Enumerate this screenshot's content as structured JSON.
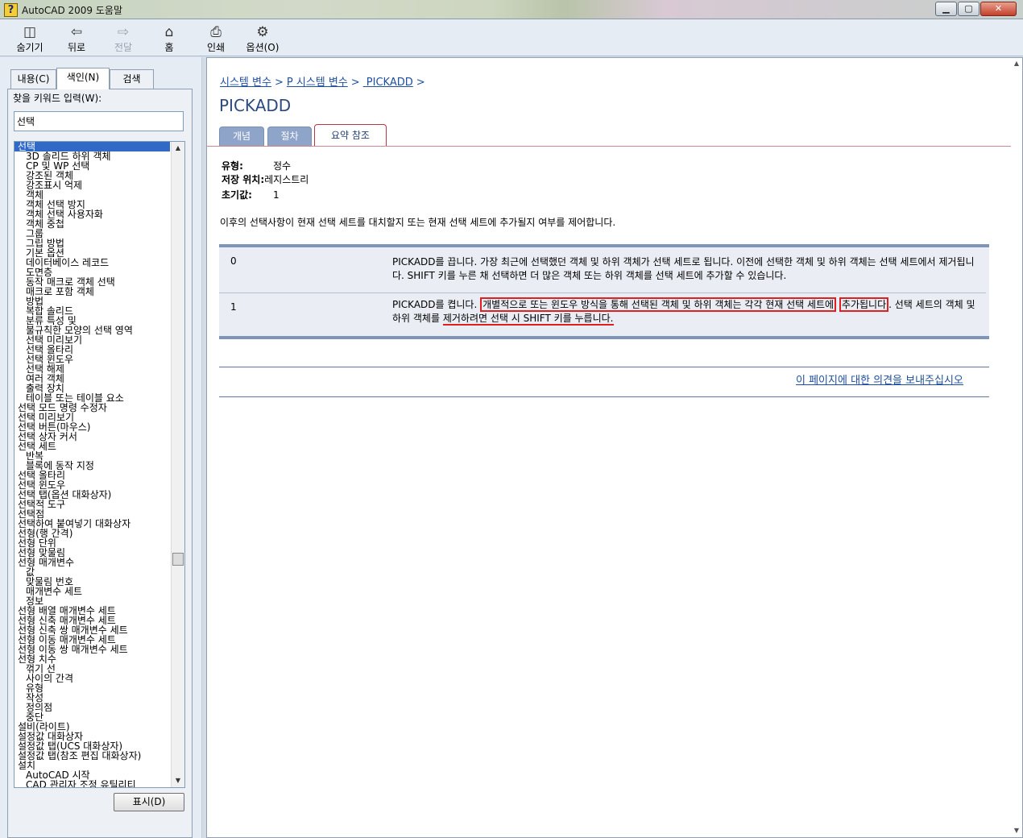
{
  "window": {
    "title": "AutoCAD 2009 도움말",
    "icon_glyph": "?",
    "min_glyph": "▁",
    "max_glyph": "▢",
    "close_glyph": "✕"
  },
  "toolbar": [
    {
      "label": "숨기기",
      "icon": "hide-icon",
      "glyph": "◫"
    },
    {
      "label": "뒤로",
      "icon": "back-arrow-icon",
      "glyph": "⇦"
    },
    {
      "label": "전달",
      "icon": "forward-arrow-icon",
      "glyph": "⇨"
    },
    {
      "label": "홈",
      "icon": "home-icon",
      "glyph": "⌂"
    },
    {
      "label": "인쇄",
      "icon": "print-icon",
      "glyph": "⎙"
    },
    {
      "label": "옵션(O)",
      "icon": "options-icon",
      "glyph": "⚙"
    }
  ],
  "left": {
    "tabs": [
      "내용(C)",
      "색인(N)",
      "검색"
    ],
    "keyword_label": "찾을 키워드 입력(W):",
    "keyword_value": "선택",
    "show_button": "표시(D)",
    "scroll_up": "▲",
    "scroll_down": "▼",
    "index": [
      {
        "t": "선택",
        "l": 0
      },
      {
        "t": "3D 솔리드 하위 객체",
        "l": 1
      },
      {
        "t": "CP 및 WP 선택",
        "l": 1
      },
      {
        "t": "강조된 객체",
        "l": 1
      },
      {
        "t": "강조표시 억제",
        "l": 1
      },
      {
        "t": "객체",
        "l": 1
      },
      {
        "t": "객체 선택 방지",
        "l": 1
      },
      {
        "t": "객체 선택 사용자화",
        "l": 1
      },
      {
        "t": "객체 중첩",
        "l": 1
      },
      {
        "t": "그룹",
        "l": 1
      },
      {
        "t": "그립 방법",
        "l": 1
      },
      {
        "t": "기본 옵션",
        "l": 1
      },
      {
        "t": "데이터베이스 레코드",
        "l": 1
      },
      {
        "t": "도면층",
        "l": 1
      },
      {
        "t": "동작 매크로 객체 선택",
        "l": 1
      },
      {
        "t": "매크로 포함 객체",
        "l": 1
      },
      {
        "t": "방법",
        "l": 1
      },
      {
        "t": "복합 솔리드",
        "l": 1
      },
      {
        "t": "분류 특성 및",
        "l": 1
      },
      {
        "t": "불규칙한 모양의 선택 영역",
        "l": 1
      },
      {
        "t": "선택 미리보기",
        "l": 1
      },
      {
        "t": "선택 올타리",
        "l": 1
      },
      {
        "t": "선택 윈도우",
        "l": 1
      },
      {
        "t": "선택 해제",
        "l": 1
      },
      {
        "t": "여러 객체",
        "l": 1
      },
      {
        "t": "출력 장치",
        "l": 1
      },
      {
        "t": "테이블 또는 테이블 요소",
        "l": 1
      },
      {
        "t": "선택 모드 명령 수정자",
        "l": 0
      },
      {
        "t": "선택 미리보기",
        "l": 0
      },
      {
        "t": "선택 버튼(마우스)",
        "l": 0
      },
      {
        "t": "선택 상자 커서",
        "l": 0
      },
      {
        "t": "선택 세트",
        "l": 0
      },
      {
        "t": "반복",
        "l": 1
      },
      {
        "t": "블록에 동작 지정",
        "l": 1
      },
      {
        "t": "선택 올타리",
        "l": 0
      },
      {
        "t": "선택 윈도우",
        "l": 0
      },
      {
        "t": "선택 탭(옵션 대화상자)",
        "l": 0
      },
      {
        "t": "선택적 도구",
        "l": 0
      },
      {
        "t": "선택점",
        "l": 0
      },
      {
        "t": "선택하여 붙여넣기 대화상자",
        "l": 0
      },
      {
        "t": "선형(행 간격)",
        "l": 0
      },
      {
        "t": "선형 단위",
        "l": 0
      },
      {
        "t": "선형 맞물림",
        "l": 0
      },
      {
        "t": "선형 매개변수",
        "l": 0
      },
      {
        "t": "값",
        "l": 1
      },
      {
        "t": "맞물림 번호",
        "l": 1
      },
      {
        "t": "매개변수 세트",
        "l": 1
      },
      {
        "t": "정보",
        "l": 1
      },
      {
        "t": "선형 배열 매개변수 세트",
        "l": 0
      },
      {
        "t": "선형 신축 매개변수 세트",
        "l": 0
      },
      {
        "t": "선형 신축 쌍 매개변수 세트",
        "l": 0
      },
      {
        "t": "선형 이동 매개변수 세트",
        "l": 0
      },
      {
        "t": "선형 이동 쌍 매개변수 세트",
        "l": 0
      },
      {
        "t": "선형 치수",
        "l": 0
      },
      {
        "t": "꺾기 선",
        "l": 1
      },
      {
        "t": "사이의 간격",
        "l": 1
      },
      {
        "t": "유형",
        "l": 1
      },
      {
        "t": "작성",
        "l": 1
      },
      {
        "t": "정의점",
        "l": 1
      },
      {
        "t": "중단",
        "l": 1
      },
      {
        "t": "설비(라이트)",
        "l": 0
      },
      {
        "t": "설정값 대화상자",
        "l": 0
      },
      {
        "t": "설정값 탭(UCS 대화상자)",
        "l": 0
      },
      {
        "t": "설정값 탭(참조 편집 대화상자)",
        "l": 0
      },
      {
        "t": "설치",
        "l": 0
      },
      {
        "t": "AutoCAD 시작",
        "l": 1
      },
      {
        "t": "CAD 관리자 조정 유틸리티",
        "l": 1
      }
    ]
  },
  "content": {
    "breadcrumb": [
      "시스템 변수",
      "P 시스템 변수",
      " PICKADD"
    ],
    "breadcrumb_sep": ">",
    "title": "PICKADD",
    "tabs": [
      "개념",
      "절차",
      "요약 참조"
    ],
    "active_tab": 2,
    "props": [
      {
        "k": "유형:",
        "v": "정수"
      },
      {
        "k": "저장 위치:",
        "v": "레지스트리"
      },
      {
        "k": "초기값:",
        "v": "1"
      }
    ],
    "description": "이후의 선택사항이 현재 선택 세트를 대치할지 또는 현재 선택 세트에 추가될지 여부를 제어합니다.",
    "values": [
      {
        "value": "0",
        "text": "PICKADD를 끕니다. 가장 최근에 선택했던 객체 및 하위 객체가 선택 세트로 됩니다. 이전에 선택한 객체 및 하위 객체는 선택 세트에서 제거됩니다. SHIFT 키를 누른 채 선택하면 더 많은 객체 또는 하위 객체를 선택 세트에 추가할 수 있습니다."
      },
      {
        "value": "1",
        "text_a": "PICKADD를 켭니다. ",
        "text_b": "개별적으로 또는 윈도우 방식을 통해 선택된 객체 및 하위 객체는 각각 현재 선택 세트에",
        "text_c": " ",
        "text_d": "추가됩니다",
        "text_e": ". 선택 세트의 객체 및 하위 객체를 ",
        "text_f": "제거하려면 선택 시 SHIFT 키를 누릅니다."
      }
    ],
    "feedback_link": "이 페이지에 대한 의견을 보내주십시오",
    "scroll_up": "▲",
    "scroll_down": "▼"
  },
  "colors": {
    "link": "#1f4fa0",
    "title": "#2c4a7e",
    "annotation": "#e0201f",
    "table_border": "#7f94b9",
    "selection": "#3169c6"
  }
}
